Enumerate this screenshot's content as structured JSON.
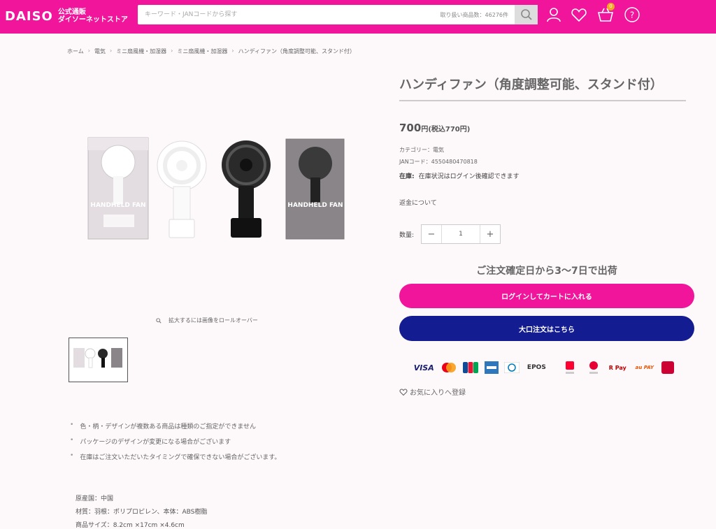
{
  "header": {
    "logo_mark": "DAISO",
    "logo_line1": "公式通販",
    "logo_line2": "ダイソーネットストア",
    "search_placeholder": "キーワード・JANコードから探す",
    "search_count": "取り扱い商品数：46276件",
    "cart_count": "0",
    "accent_color": "#f0159a"
  },
  "breadcrumb": [
    "ホーム",
    "電気",
    "ミニ扇風機・加湿器",
    "ミニ扇風機・加湿器",
    "ハンディファン（角度調整可能、スタンド付）"
  ],
  "image": {
    "zoom_hint": "拡大するには画像をロールオーバー",
    "box_label": "HANDHELD FAN"
  },
  "product": {
    "title": "ハンディファン（角度調整可能、スタンド付）",
    "price": "700",
    "price_unit": "円",
    "price_tax": "(税込770円)",
    "category": "カテゴリー：電気",
    "jan": "JANコード：4550480470818",
    "stock_label": "在庫:",
    "stock_value": "在庫状況はログイン後確認できます",
    "refund": "返金について",
    "qty_label": "数量:",
    "qty_minus": "−",
    "qty_value": "1",
    "qty_plus": "+",
    "shipping": "ご注文確定日から3〜7日で出荷",
    "cart_button": "ログインしてカートに入れる",
    "bulk_button": "大口注文はこちら",
    "favorite": "お気に入りへ登録",
    "bulk_color": "#131c91"
  },
  "payments": [
    "VISA",
    "Mastercard",
    "JCB",
    "AMERICAN EXPRESS",
    "Diners Club",
    "EPOS",
    "PayPay",
    "d払い Pay",
    "R Pay",
    "au PAY",
    "d払い"
  ],
  "notes": [
    "色・柄・デザインが複数ある商品は種類のご指定ができません",
    "パッケージのデザインが変更になる場合がございます",
    "在庫はご注文いただいたタイミングで確保できない場合がございます。"
  ],
  "specs": [
    "原産国：中国",
    "材質：羽根：ポリプロピレン、本体：ABS樹脂",
    "商品サイズ：8.2cm ×17cm ×4.6cm"
  ]
}
